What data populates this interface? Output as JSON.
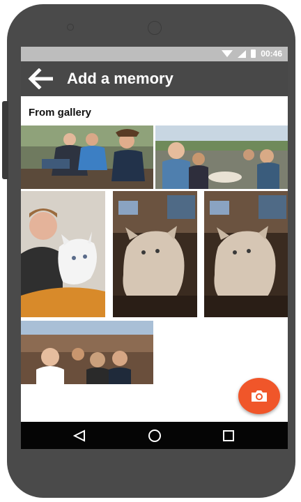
{
  "statusbar": {
    "time": "00:46",
    "icons": [
      "wifi-icon",
      "signal-icon",
      "battery-icon"
    ]
  },
  "appbar": {
    "title": "Add a memory",
    "back_icon": "arrow-back-icon"
  },
  "gallery": {
    "title": "From gallery",
    "photos": [
      {
        "subject": "group-outdoors"
      },
      {
        "subject": "group-picnic"
      },
      {
        "subject": "man-with-cat"
      },
      {
        "subject": "cat-indoors"
      },
      {
        "subject": "cat-indoors"
      },
      {
        "subject": "group-canyon-selfie"
      }
    ]
  },
  "fab": {
    "icon": "camera-icon"
  },
  "navbar": {
    "buttons": [
      "back-nav-icon",
      "home-nav-icon",
      "recents-nav-icon"
    ]
  },
  "colors": {
    "appbar": "#484848",
    "statusbar": "#bdbdbd",
    "accent": "#f0562a",
    "navbar": "#050505"
  }
}
